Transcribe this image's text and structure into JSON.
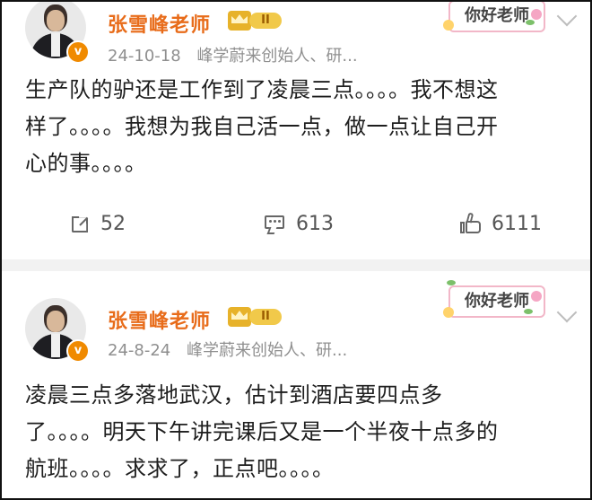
{
  "posts": [
    {
      "username": "张雪峰老师",
      "level": "II",
      "verified_mark": "v",
      "date": "24-10-18",
      "bio": "峰学蔚来创始人、研...",
      "sticker_text": "你好老师",
      "text_lines": [
        "生产队的驴还是工作到了凌晨三点。。。。我不想这",
        "样了。。。。我想为我自己活一点，做一点让自己开",
        "心的事。。。。"
      ],
      "shares": "52",
      "comments": "613",
      "likes": "6111"
    },
    {
      "username": "张雪峰老师",
      "level": "II",
      "verified_mark": "v",
      "date": "24-8-24",
      "bio": "峰学蔚来创始人、研...",
      "sticker_text": "你好老师",
      "text_lines": [
        "凌晨三点多落地武汉，估计到酒店要四点多",
        "了。。。。明天下午讲完课后又是一个半夜十点多的",
        "航班。。。。求求了，正点吧。。。。"
      ]
    }
  ],
  "icons": {
    "share": "share-icon",
    "comment": "comment-icon",
    "like": "like-icon",
    "more": "chevron-down-icon",
    "verified": "verified-badge-icon",
    "level": "crown-icon"
  },
  "colors": {
    "username": "#e86c1a",
    "verified": "#f08a00",
    "meta": "#8f8f8f",
    "separator": "#f2f2f2",
    "level": "#f1c94a"
  }
}
